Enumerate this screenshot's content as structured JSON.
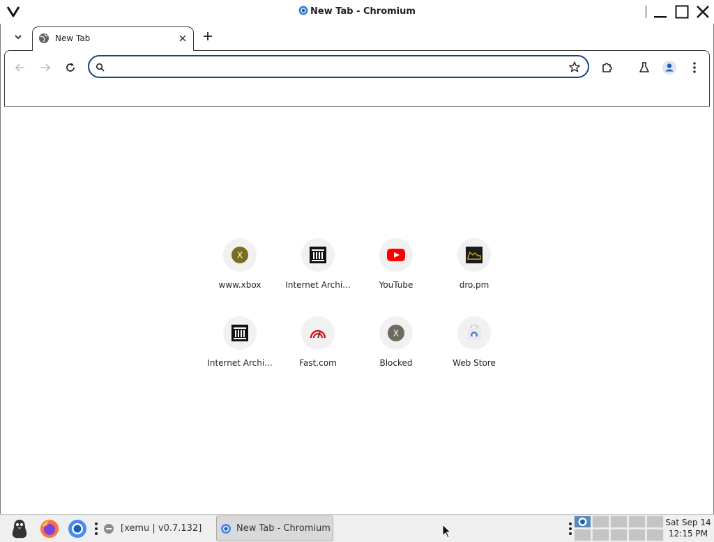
{
  "window": {
    "title": "New Tab - Chromium"
  },
  "tabs": [
    {
      "title": "New Tab",
      "active": true
    }
  ],
  "omnibox": {
    "value": "",
    "placeholder": ""
  },
  "shortcuts": [
    {
      "label": "www.xbox",
      "icon": "xbox-letter-icon"
    },
    {
      "label": "Internet Archi...",
      "icon": "internet-archive-icon"
    },
    {
      "label": "YouTube",
      "icon": "youtube-icon"
    },
    {
      "label": "dro.pm",
      "icon": "dro-pm-icon"
    },
    {
      "label": "Internet Archi...",
      "icon": "internet-archive-icon"
    },
    {
      "label": "Fast.com",
      "icon": "fast-com-icon"
    },
    {
      "label": "Blocked",
      "icon": "blocked-letter-icon"
    },
    {
      "label": "Web Store",
      "icon": "web-store-icon"
    }
  ],
  "taskbar": {
    "tasks": [
      {
        "label": "[xemu | v0.7.132]",
        "active": false
      },
      {
        "label": "New Tab - Chromium",
        "active": true
      }
    ],
    "clock": {
      "date": "Sat Sep 14",
      "time": "12:15 PM"
    }
  },
  "colors": {
    "omnibox_border": "#1a3f88",
    "avatar_blue": "#1a5fb4",
    "youtube_red": "#ff0000",
    "xbox_olive": "#7a6e1c",
    "blocked_gray": "#6f6a5e"
  }
}
